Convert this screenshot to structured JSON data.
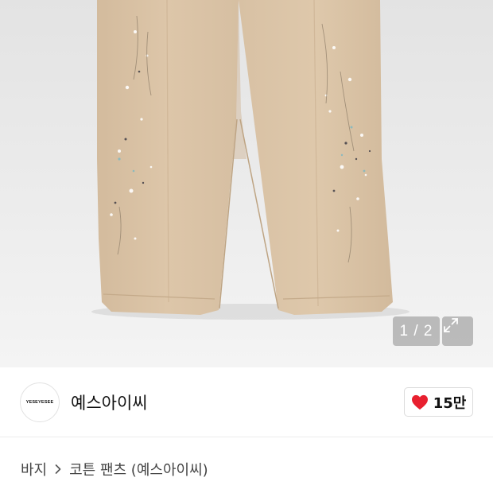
{
  "gallery": {
    "counter": "1 / 2",
    "expand_icon": "expand-icon",
    "colors": {
      "background": "#e8e8e8",
      "pants": "#dbc4a7",
      "counter_bg": "#8c8c8c"
    }
  },
  "brand": {
    "logo_text": "YESEYESEE",
    "name": "예스아이씨"
  },
  "like": {
    "icon": "heart-icon",
    "count": "15만",
    "color": "#e8202f"
  },
  "breadcrumb": {
    "category": "바지",
    "separator_icon": "chevron-right-icon",
    "product": "코튼 팬츠 (예스아이씨)"
  }
}
